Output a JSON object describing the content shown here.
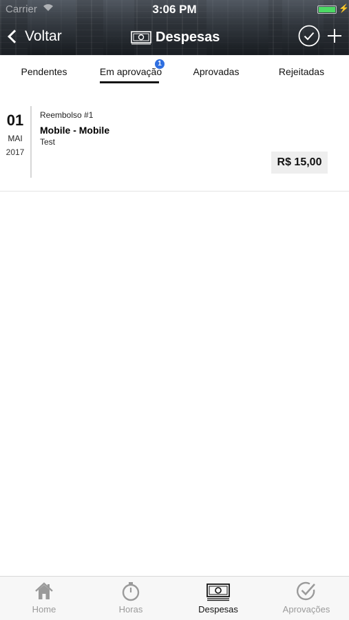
{
  "status_bar": {
    "carrier": "Carrier",
    "time": "3:06 PM",
    "battery_color": "#4cd964"
  },
  "nav": {
    "back_label": "Voltar",
    "title": "Despesas",
    "title_icon": "money-icon",
    "actions": [
      "check-circle-icon",
      "plus-icon"
    ]
  },
  "tabs": {
    "pendentes": "Pendentes",
    "em_aprovacao": "Em aprovação",
    "aprovadas": "Aprovadas",
    "rejeitadas": "Rejeitadas",
    "active": "em_aprovacao",
    "badge_count": "1",
    "badge_color": "#2f6fe0"
  },
  "expense": {
    "day": "01",
    "month": "MAI",
    "year": "2017",
    "reference": "Reembolso #1",
    "title": "Mobile - Mobile",
    "description": "Test",
    "amount": "R$ 15,00"
  },
  "tabbar": {
    "items": [
      {
        "label": "Home",
        "icon": "home-icon",
        "active": false
      },
      {
        "label": "Horas",
        "icon": "stopwatch-icon",
        "active": false
      },
      {
        "label": "Despesas",
        "icon": "money-icon",
        "active": true
      },
      {
        "label": "Aprovações",
        "icon": "check-circle-icon",
        "active": false
      }
    ]
  }
}
